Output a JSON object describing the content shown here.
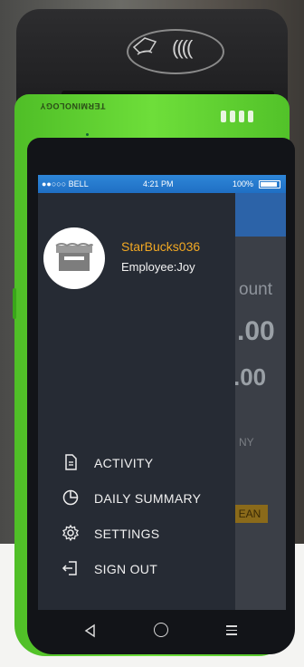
{
  "device": {
    "brand": "TERMINOLOGY"
  },
  "status_bar": {
    "carrier": "●●○○○ BELL",
    "time": "4:21 PM",
    "battery": "100%"
  },
  "profile": {
    "store_name": "StarBucks036",
    "employee": "Employee:Joy"
  },
  "menu": [
    {
      "label": "ACTIVITY",
      "icon": "document-icon"
    },
    {
      "label": "DAILY SUMMARY",
      "icon": "pie-chart-icon"
    },
    {
      "label": "SETTINGS",
      "icon": "gear-icon"
    },
    {
      "label": "SIGN OUT",
      "icon": "sign-out-icon"
    }
  ],
  "background_screen": {
    "label": "ount",
    "amount_1": ".00",
    "amount_2": ".00",
    "small": "NY",
    "button": "EAN"
  },
  "colors": {
    "device_green": "#5fcf30",
    "drawer": "#262b34",
    "status_bar": "#1f6fc4",
    "accent": "#f1a823"
  }
}
